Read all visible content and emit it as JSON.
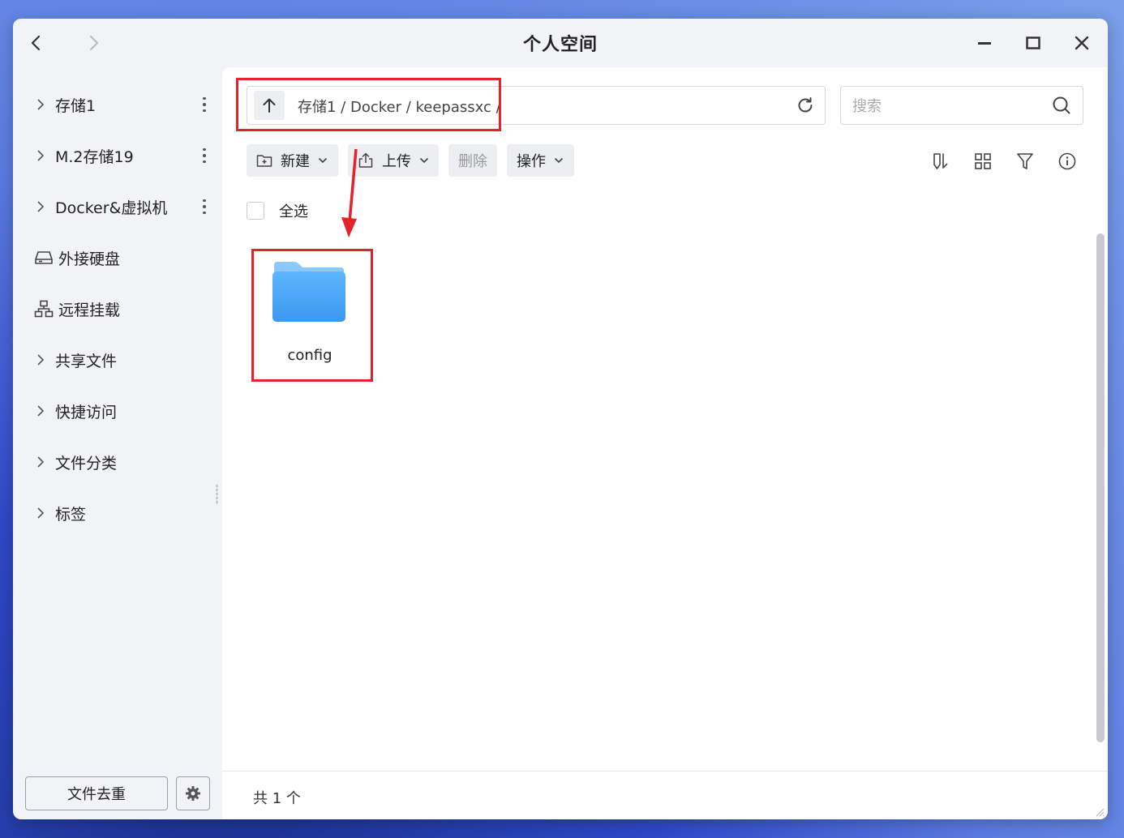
{
  "window": {
    "title": "个人空间"
  },
  "sidebar": {
    "items": [
      {
        "label": "存储1",
        "icon": "chevron-right-icon",
        "has_menu": true
      },
      {
        "label": "M.2存储19",
        "icon": "chevron-right-icon",
        "has_menu": true
      },
      {
        "label": "Docker&虚拟机",
        "icon": "chevron-right-icon",
        "has_menu": true
      },
      {
        "label": "外接硬盘",
        "icon": "external-drive-icon"
      },
      {
        "label": "远程挂载",
        "icon": "network-mount-icon"
      },
      {
        "label": "共享文件",
        "icon": "chevron-right-icon"
      },
      {
        "label": "快捷访问",
        "icon": "chevron-right-icon"
      },
      {
        "label": "文件分类",
        "icon": "chevron-right-icon"
      },
      {
        "label": "标签",
        "icon": "chevron-right-icon"
      }
    ],
    "dedup_label": "文件去重"
  },
  "pathbar": {
    "path": "存储1 / Docker / keepassxc /"
  },
  "search": {
    "placeholder": "搜索"
  },
  "toolbar": {
    "new_label": "新建",
    "upload_label": "上传",
    "delete_label": "删除",
    "action_label": "操作"
  },
  "list": {
    "select_all_label": "全选",
    "items": [
      {
        "name": "config",
        "type": "folder"
      }
    ]
  },
  "status": {
    "count_text": "共 1 个"
  },
  "colors": {
    "annotation": "#e3222b",
    "folder": "#4ea7f7",
    "bg": "#f2f3f7"
  }
}
